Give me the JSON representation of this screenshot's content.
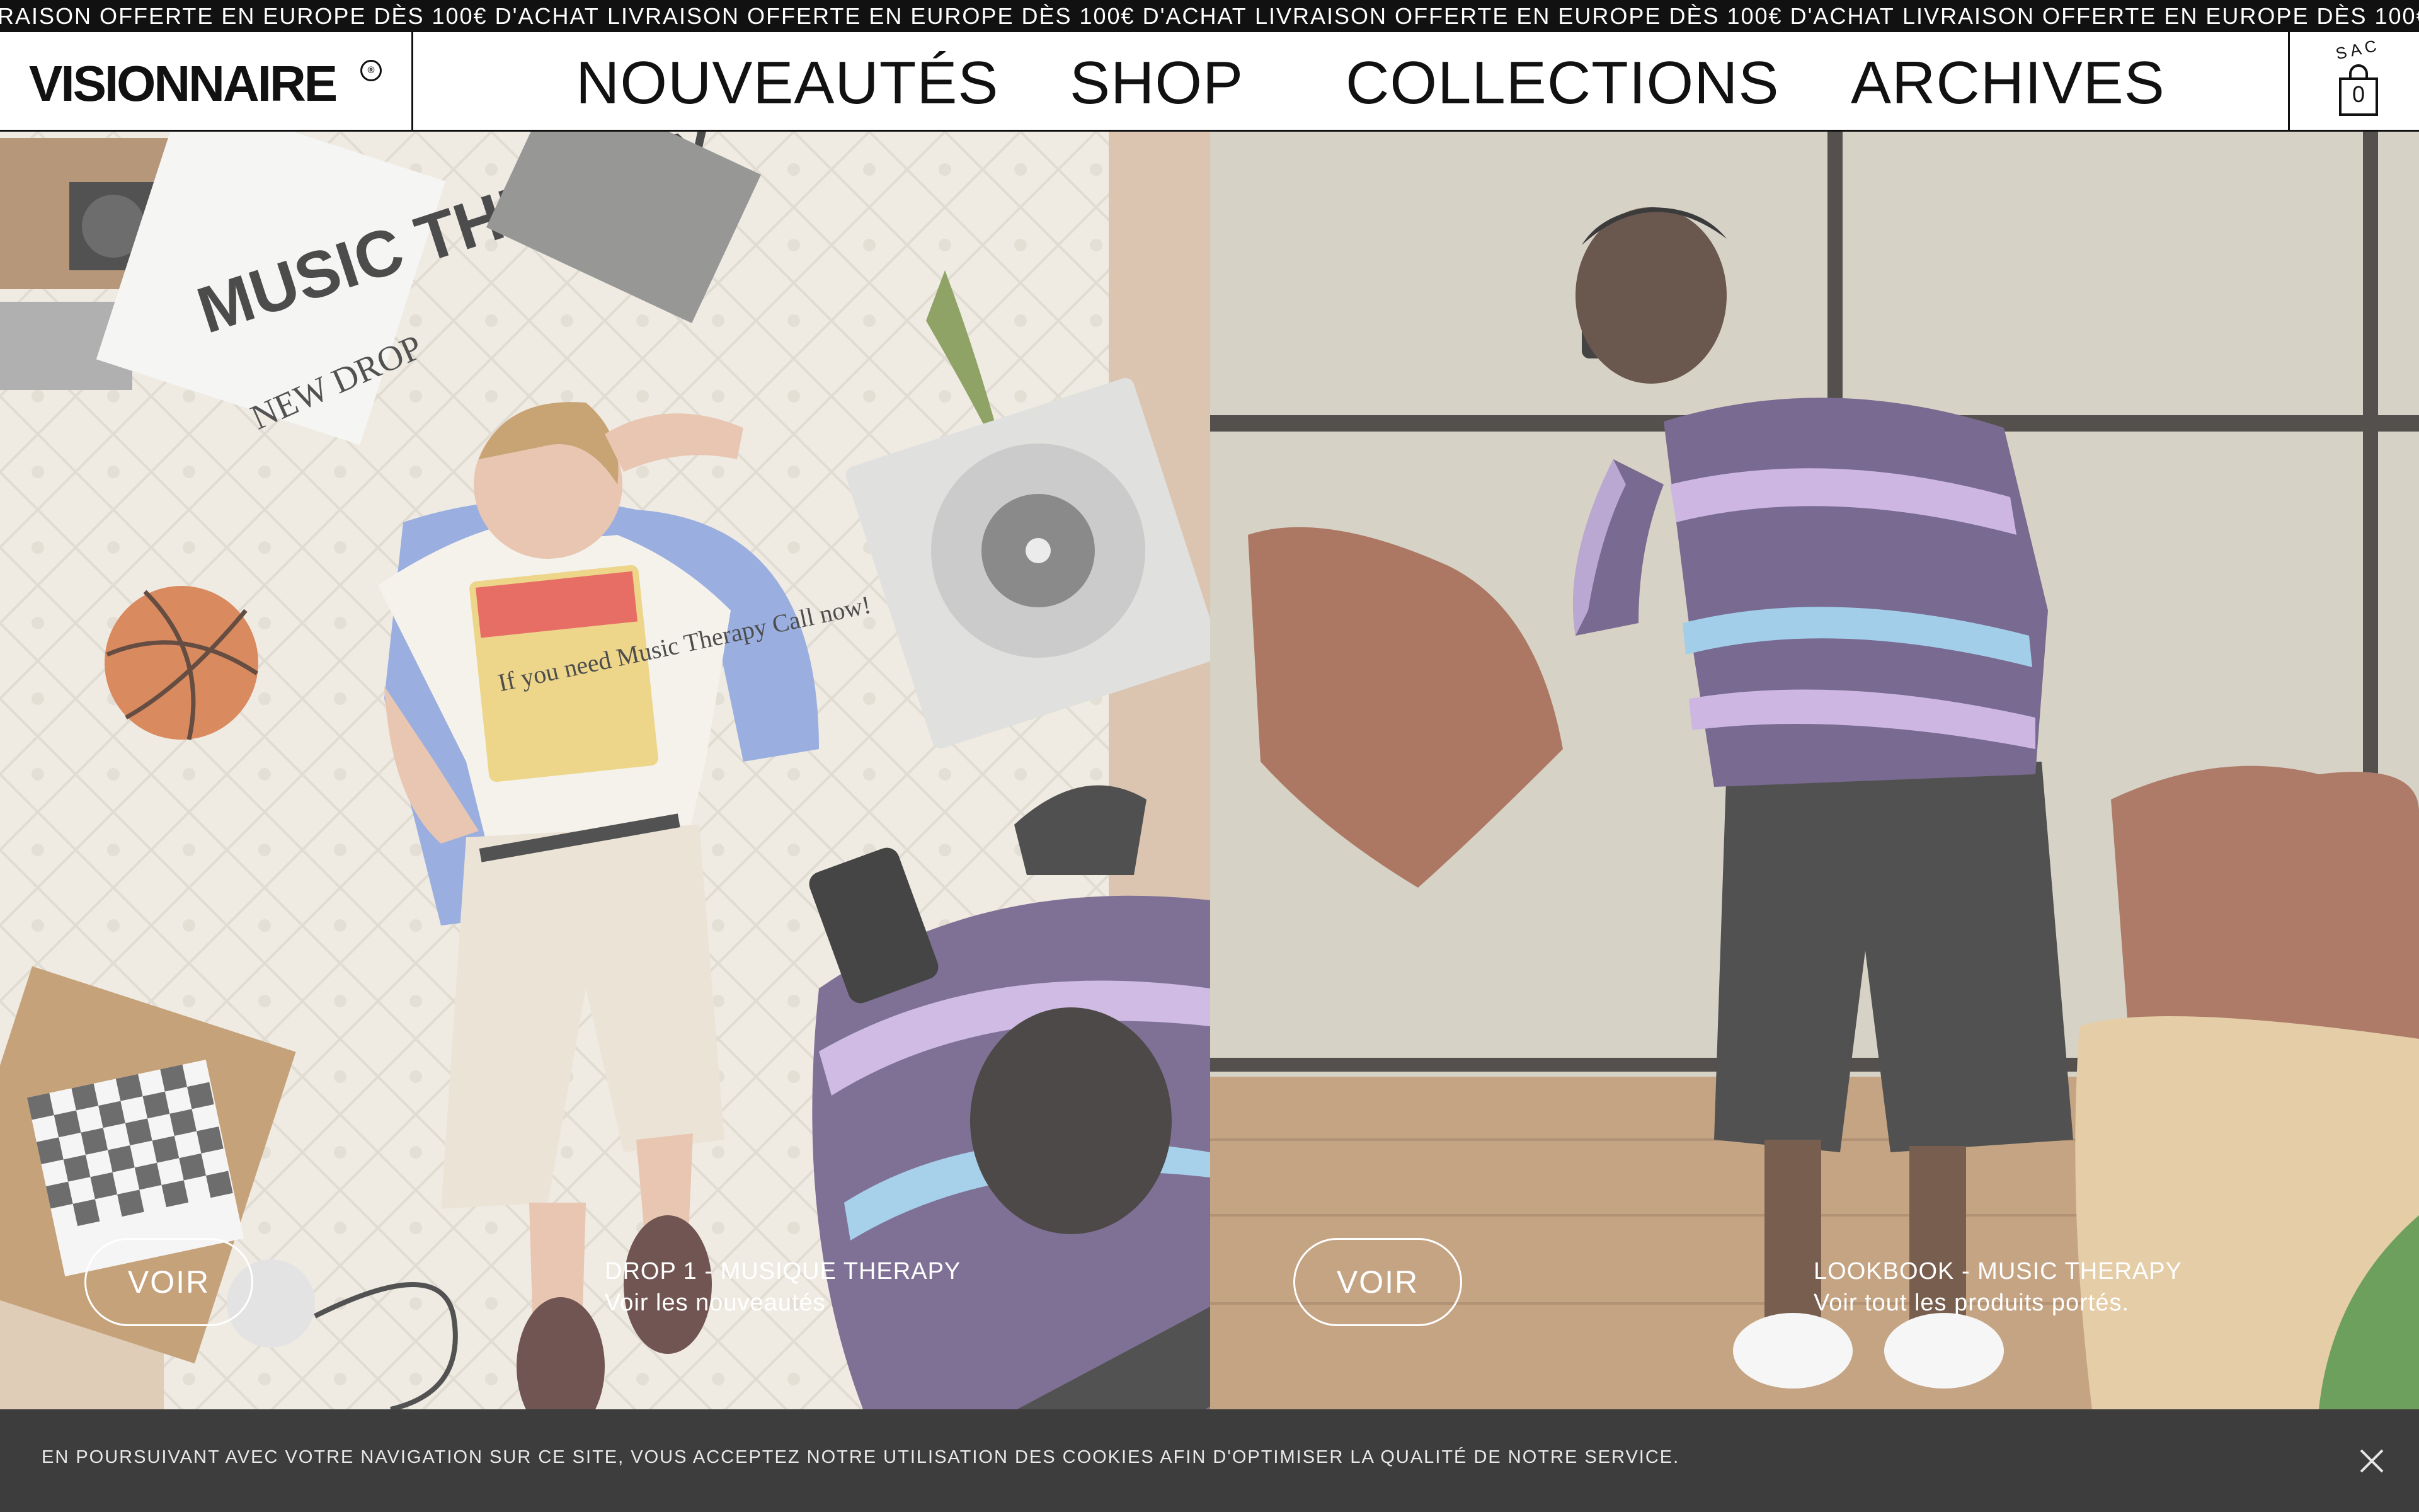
{
  "promo": {
    "message": "LIVRAISON OFFERTE EN EUROPE DÈS 100€ D'ACHAT",
    "items": [
      "LIVRAISON OFFERTE EN EUROPE DÈS 100€ D'ACHAT",
      "LIVRAISON OFFERTE EN EUROPE DÈS 100€ D'ACHAT",
      "LIVRAISON OFFERTE EN EUROPE DÈS 100€ D'ACHAT",
      "LIVRAISON OFFERTE EN EUROPE DÈS 100€ D'ACHAT"
    ]
  },
  "header": {
    "logo": "VISIONNAIRE",
    "logo_mark": "®",
    "nav": [
      "NOUVEAUTÉS",
      "SHOP",
      "COLLECTIONS",
      "ARCHIVES"
    ],
    "bag_label": "SAC",
    "bag_count": "0"
  },
  "hero": {
    "left": {
      "button": "VOIR",
      "title": "DROP 1 - MUSIQUE THERAPY",
      "subtitle": "Voir les nouveautés",
      "poster_text": "MUSIC THERAPY",
      "poster_sub": "NEW DROP",
      "shirt_text": "If you need Music Therapy Call now!"
    },
    "right": {
      "button": "VOIR",
      "title": "LOOKBOOK - MUSIC THERAPY",
      "subtitle": "Voir tout les produits portés."
    }
  },
  "cookie": {
    "text": "EN POURSUIVANT AVEC VOTRE NAVIGATION SUR CE SITE, VOUS ACCEPTEZ NOTRE UTILISATION DES COOKIES AFIN D'OPTIMISER LA QUALITÉ DE NOTRE SERVICE.",
    "close_icon": "close-icon"
  },
  "colors": {
    "ink": "#111111",
    "promo_bg": "#111111",
    "cookie_bg": "#3d3d3d",
    "sweater_purple": "#5b4a78",
    "sweater_lilac": "#c2a8dc",
    "sweater_blue": "#8fc4e6"
  }
}
